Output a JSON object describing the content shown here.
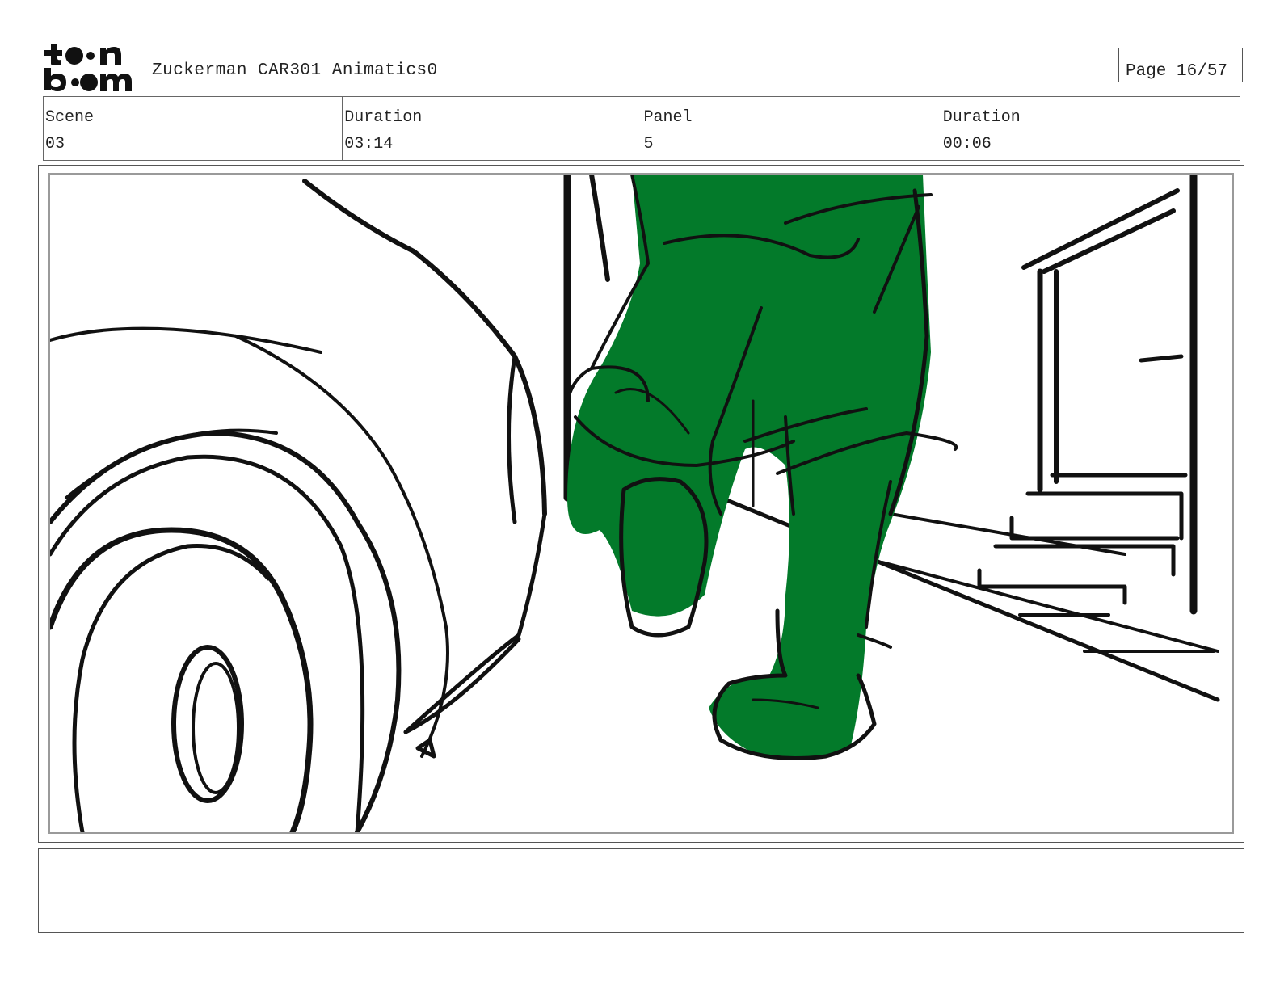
{
  "header": {
    "logo_text": "toon boom",
    "title": "Zuckerman CAR301 Animatics0",
    "page": "Page 16/57"
  },
  "info": {
    "columns": [
      {
        "label": "Scene",
        "value": "03"
      },
      {
        "label": "Duration",
        "value": "03:14"
      },
      {
        "label": "Panel",
        "value": "5"
      },
      {
        "label": "Duration",
        "value": "00:06"
      }
    ]
  },
  "panel": {
    "icon": "storyboard-sketch-image",
    "character_fill": "#037a2a",
    "line_color": "#111111"
  },
  "notes": {
    "text": ""
  }
}
